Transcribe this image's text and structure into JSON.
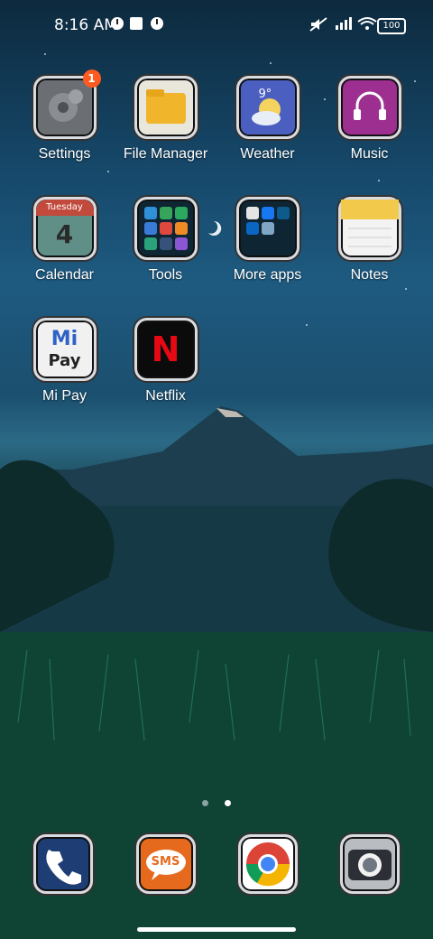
{
  "status_bar": {
    "time": "8:16 AM",
    "battery": "100"
  },
  "apps": [
    {
      "label": "Settings",
      "icon": "gear-icon",
      "badge": "1"
    },
    {
      "label": "File Manager",
      "icon": "folder-icon"
    },
    {
      "label": "Weather",
      "icon": "weather-icon",
      "temp": "9°"
    },
    {
      "label": "Music",
      "icon": "headphones-icon"
    },
    {
      "label": "Calendar",
      "icon": "calendar-icon",
      "weekday": "Tuesday",
      "day": "4"
    },
    {
      "label": "Tools",
      "icon": "tools-folder-icon"
    },
    {
      "label": "More apps",
      "icon": "more-apps-folder-icon"
    },
    {
      "label": "Notes",
      "icon": "notes-icon"
    },
    {
      "label": "Mi Pay",
      "icon": "mi-pay-icon",
      "text_top": "Mi",
      "text_bottom": "Pay"
    },
    {
      "label": "Netflix",
      "icon": "netflix-icon",
      "letter": "N"
    }
  ],
  "dock": [
    {
      "name": "phone",
      "icon": "phone-icon"
    },
    {
      "name": "messages",
      "icon": "sms-icon",
      "text": "SMS"
    },
    {
      "name": "chrome",
      "icon": "chrome-icon"
    },
    {
      "name": "camera",
      "icon": "camera-icon"
    }
  ],
  "page_indicator": {
    "pages": 2,
    "current": 2
  },
  "colors": {
    "badge": "#ff5a1f",
    "accent": "#2b6a86"
  }
}
